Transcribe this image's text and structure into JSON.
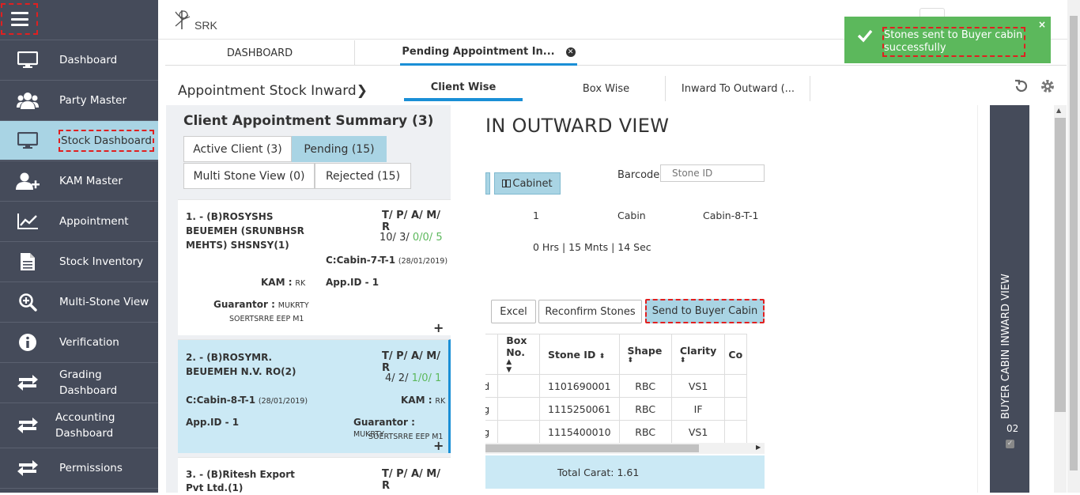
{
  "app": {
    "logo_text": "SRK"
  },
  "sidebar": {
    "items": [
      {
        "label": "Dashboard",
        "icon": "monitor-icon"
      },
      {
        "label": "Party Master",
        "icon": "users-icon"
      },
      {
        "label": "Stock Dashboard",
        "icon": "monitor-icon",
        "active": true
      },
      {
        "label": "KAM Master",
        "icon": "add-user-icon"
      },
      {
        "label": "Appointment",
        "icon": "chart-icon"
      },
      {
        "label": "Stock Inventory",
        "icon": "document-icon"
      },
      {
        "label": "Multi-Stone View",
        "icon": "zoom-in-icon"
      },
      {
        "label": "Verification",
        "icon": "info-icon"
      },
      {
        "label": "Grading Dashboard",
        "icon": "transfer-icon"
      },
      {
        "label": "Accounting Dashboard",
        "icon": "transfer-icon"
      },
      {
        "label": "Permissions",
        "icon": "transfer-icon"
      }
    ]
  },
  "tabs": {
    "dashboard": "DASHBOARD",
    "pending": "Pending Appointment In..."
  },
  "header": {
    "title": "Appointment Stock Inward",
    "subtabs": [
      "Client Wise",
      "Box Wise",
      "Inward To Outward (..."
    ]
  },
  "summary": {
    "title": "Client Appointment Summary (3)",
    "buttons": {
      "active": "Active Client (3)",
      "pending": "Pending (15)",
      "multi": "Multi Stone View (0)",
      "rejected": "Rejected (15)"
    },
    "cards": [
      {
        "name": "1. - (B)ROSYSHS BEUEMEH (SRUNBHSR MEHTS) SHSNSY(1)",
        "tpam_label": "T/ P/ A/ M/ R",
        "t": "10/",
        "p": "3/",
        "a": "0/",
        "m": "0/",
        "r": "5",
        "cabin": "C:Cabin-7-T-1",
        "date": "(28/01/2019)",
        "kam_label": "KAM :",
        "kam": "RK",
        "app": "App.ID - 1",
        "guarantor_label": "Guarantor :",
        "guarantor": "MUKRTY",
        "guarantor2": "SOERTSRRE EEP M1"
      },
      {
        "name": "2. - (B)ROSYMR. BEUEMEH N.V. RO(2)",
        "tpam_label": "T/ P/ A/ M/ R",
        "t": "4/",
        "p": "2/",
        "a": "1/",
        "m": "0/",
        "r": "1",
        "cabin": "C:Cabin-8-T-1",
        "date": "(28/01/2019)",
        "kam_label": "KAM :",
        "kam": "RK",
        "app": "App.ID - 1",
        "guarantor_label": "Guarantor :",
        "guarantor": "MUKRTY",
        "guarantor2": "SOERTSRRE EEP M1"
      },
      {
        "name": "3. - (B)Ritesh Export Pvt Ltd.(1)",
        "tpam_label": "T/ P/ A/ M/ R"
      }
    ]
  },
  "view": {
    "title": "IN OUTWARD VIEW",
    "cabinet_btn": "Cabinet",
    "barcode_label": "Barcode",
    "barcode_placeholder": "Stone ID",
    "count": "1",
    "cabin_label": "Cabin",
    "cabin_value": "Cabin-8-T-1",
    "timer": "0 Hrs | 15 Mnts | 14 Sec",
    "excel_btn": "Excel",
    "reconfirm_btn": "Reconfirm Stones",
    "send_btn": "Send to Buyer Cabin",
    "table": {
      "headers": [
        "Box No.",
        "Stone ID",
        "Shape",
        "Clarity",
        "Co"
      ],
      "rows": [
        {
          "status": "ed",
          "box": "",
          "stone": "1101690001",
          "shape": "RBC",
          "clarity": "VS1"
        },
        {
          "status": "ng",
          "box": "",
          "stone": "1115250061",
          "shape": "RBC",
          "clarity": "IF"
        },
        {
          "status": "ng",
          "box": "",
          "stone": "1115400010",
          "shape": "RBC",
          "clarity": "VS1"
        }
      ]
    },
    "total_carat": "Total Carat: 1.61"
  },
  "right_panel": {
    "label": "BUYER CABIN INWARD VIEW",
    "number": "02"
  },
  "toast": {
    "message": "Stones sent to Buyer cabin successfully"
  },
  "colors": {
    "sidebar": "#454b5a",
    "active": "#a9d4e4",
    "accent": "#1a8fd6",
    "toast": "#5cb85c"
  }
}
